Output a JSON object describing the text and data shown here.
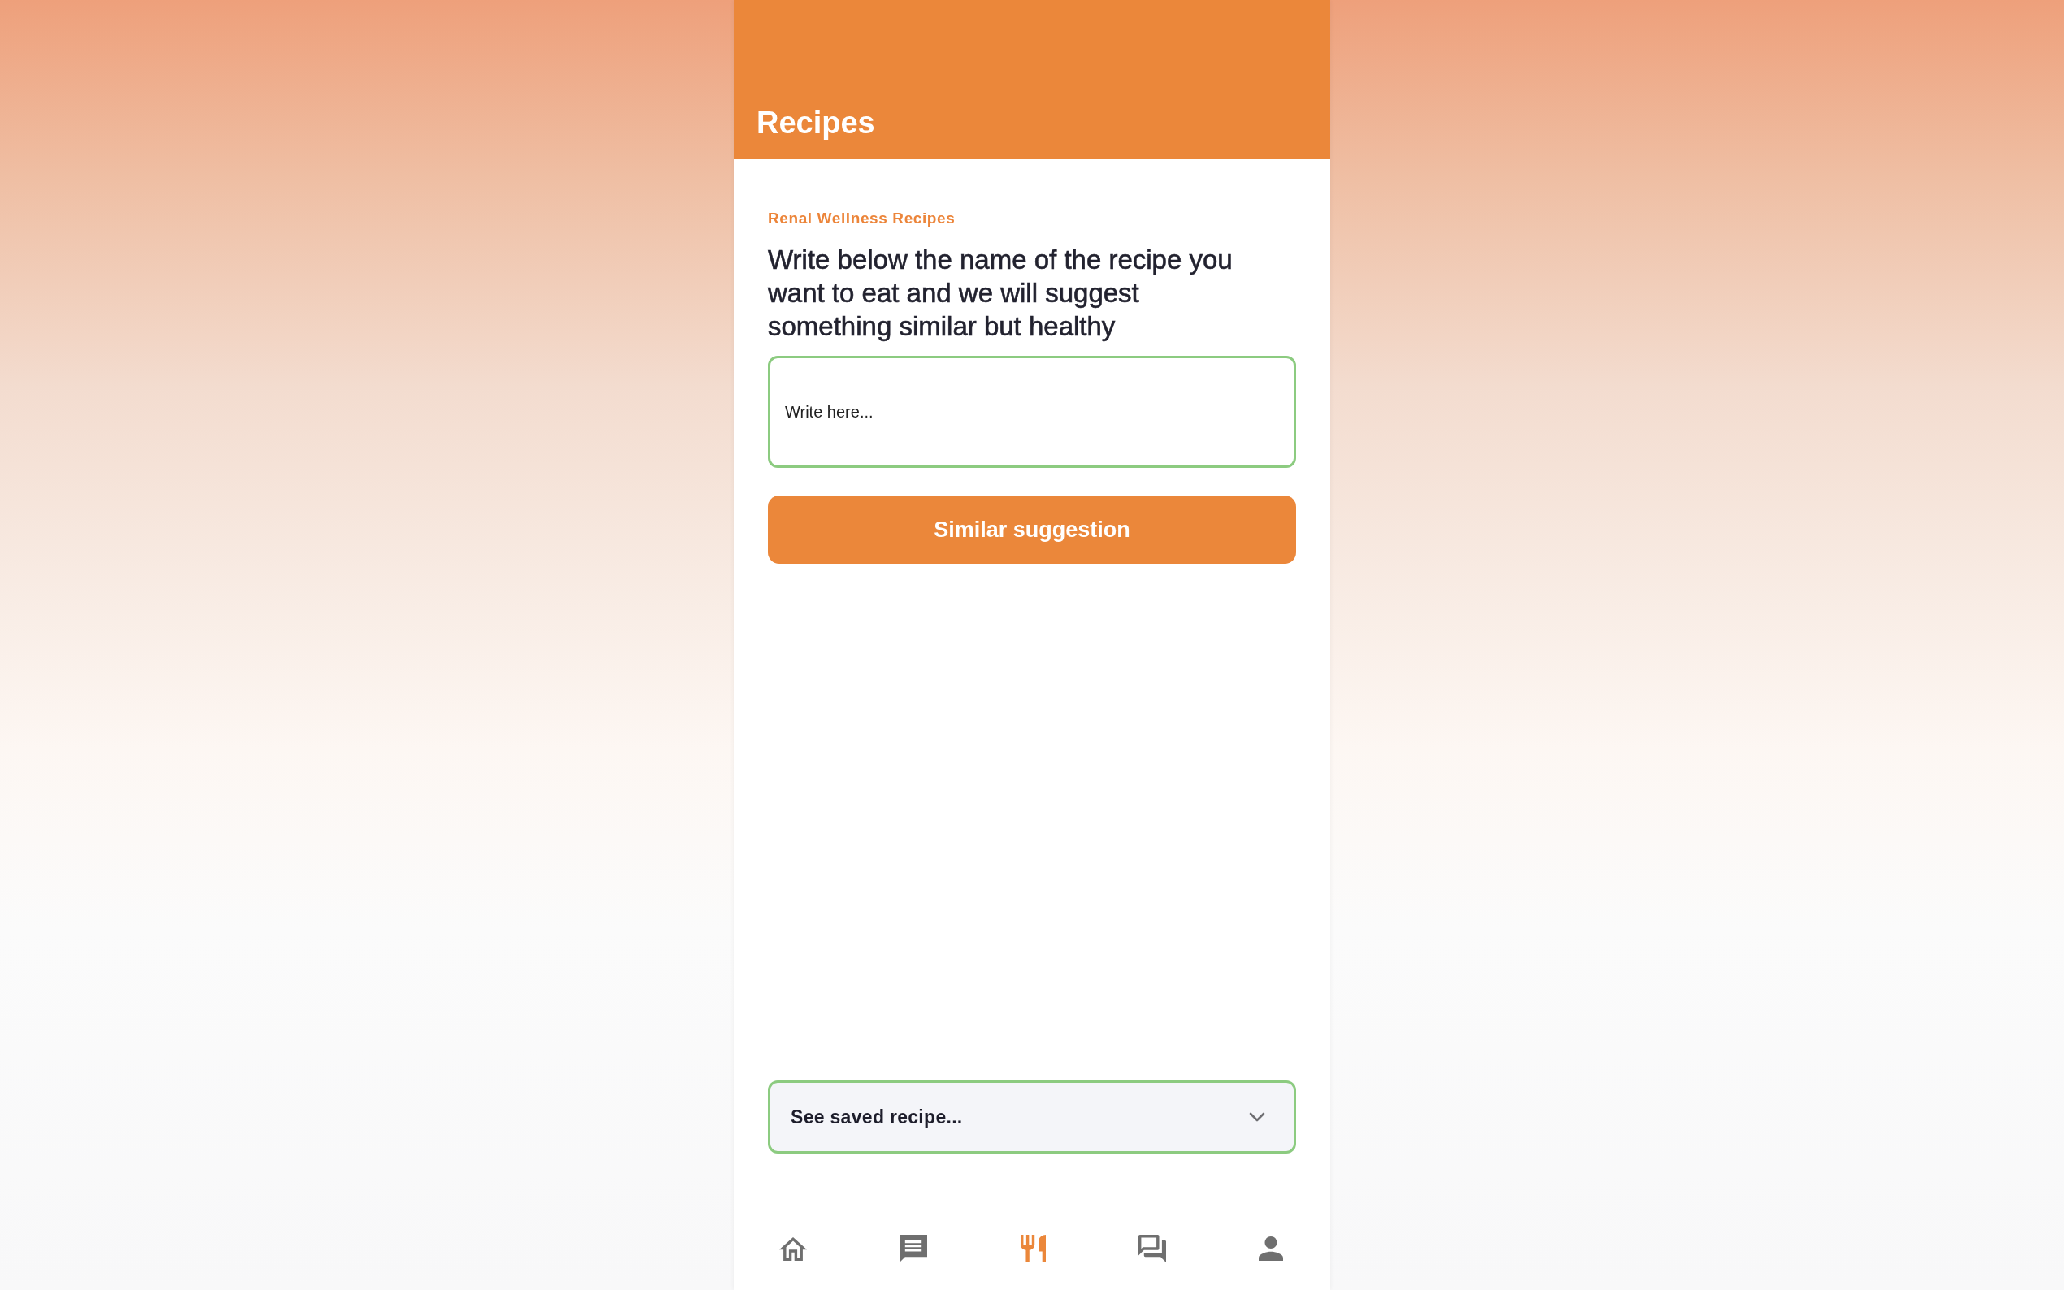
{
  "header": {
    "title": "Recipes"
  },
  "content": {
    "eyebrow": "Renal Wellness Recipes",
    "heading": "Write below the name of the recipe you want to eat and we will suggest something similar but healthy",
    "input": {
      "placeholder": "Write here..."
    },
    "button": {
      "label": "Similar suggestion"
    }
  },
  "saved_recipes": {
    "label": "See saved recipe...",
    "expanded": false
  },
  "bottom_nav": {
    "items": [
      {
        "selected": false
      },
      {
        "selected": false
      },
      {
        "selected": true
      },
      {
        "selected": false
      },
      {
        "selected": false
      }
    ]
  }
}
